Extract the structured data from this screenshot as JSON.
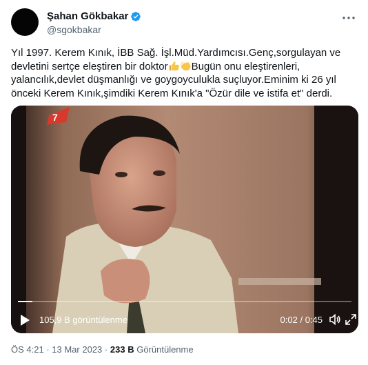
{
  "author": {
    "display_name": "Şahan Gökbakar",
    "handle": "@sgokbakar",
    "verified": true,
    "badge_color": "#1d9bf0"
  },
  "tweet": {
    "text_part1": "Yıl 1997. Kerem Kınık, İBB Sağ. İşl.Müd.Yardımcısı.Genç,sorgulayan ve devletini sertçe eleştiren bir doktor",
    "emojis": [
      "thumbs-up-emoji",
      "clapping-hands-emoji"
    ],
    "text_part2": "Bugün onu eleştirenleri, yalancılık,devlet düşmanlığı ve goygoyculukla suçluyor.Eminim ki 26 yıl önceki Kerem Kınık,şimdiki Kerem Kınık'a \"Özür dile ve istifa et\" derdi."
  },
  "video": {
    "views_label": "105,9 B görüntülenme",
    "time_current": "0:02",
    "time_total": "0:45",
    "progress_fraction": 0.044
  },
  "meta": {
    "time": "ÖS 4:21",
    "separator": "·",
    "date": "13 Mar 2023",
    "views_count": "233 B",
    "views_label": "Görüntülenme"
  },
  "colors": {
    "text": "#0f1419",
    "secondary": "#536471",
    "verified": "#1d9bf0"
  }
}
